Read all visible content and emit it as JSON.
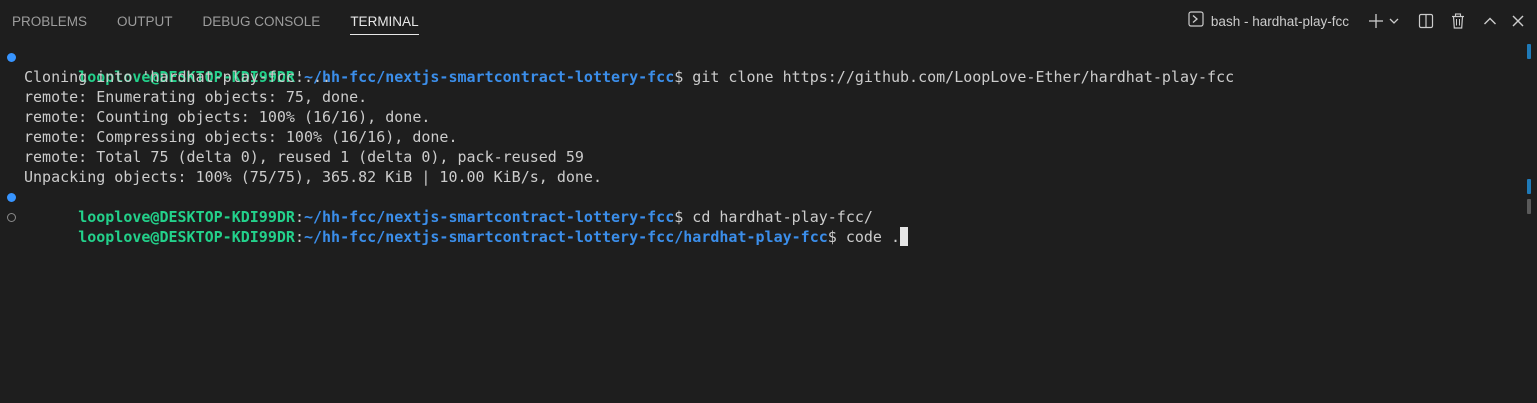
{
  "tabs": [
    {
      "label": "PROBLEMS",
      "active": false
    },
    {
      "label": "OUTPUT",
      "active": false
    },
    {
      "label": "DEBUG CONSOLE",
      "active": false
    },
    {
      "label": "TERMINAL",
      "active": true
    }
  ],
  "terminal_selector": {
    "icon": "terminal-icon",
    "label": "bash - hardhat-play-fcc"
  },
  "actions": {
    "new_terminal_icon": "plus-icon",
    "launch_profile_icon": "chevron-down-icon",
    "split_icon": "split-terminal-icon",
    "kill_icon": "trash-icon",
    "maximize_icon": "chevron-up-icon",
    "close_icon": "close-icon"
  },
  "colors": {
    "background": "#1e1e1e",
    "prompt_user": "#23d18b",
    "prompt_path": "#3b8eea",
    "text": "#cccccc",
    "decoration_success": "#3794ff",
    "ruler_mark": "#1f7ab8"
  },
  "terminal": {
    "lines": [
      {
        "type": "prompt",
        "decoration": "success",
        "user": "looplove@DESKTOP-KDI99DR",
        "sep": ":",
        "path": "~/hh-fcc/nextjs-smartcontract-lottery-fcc",
        "symbol": "$",
        "command": " git clone https://github.com/LoopLove-Ether/hardhat-play-fcc"
      },
      {
        "type": "output",
        "text": "Cloning into 'hardhat-play-fcc'..."
      },
      {
        "type": "output",
        "text": "remote: Enumerating objects: 75, done."
      },
      {
        "type": "output",
        "text": "remote: Counting objects: 100% (16/16), done."
      },
      {
        "type": "output",
        "text": "remote: Compressing objects: 100% (16/16), done."
      },
      {
        "type": "output",
        "text": "remote: Total 75 (delta 0), reused 1 (delta 0), pack-reused 59"
      },
      {
        "type": "output",
        "text": "Unpacking objects: 100% (75/75), 365.82 KiB | 10.00 KiB/s, done."
      },
      {
        "type": "prompt",
        "decoration": "success",
        "user": "looplove@DESKTOP-KDI99DR",
        "sep": ":",
        "path": "~/hh-fcc/nextjs-smartcontract-lottery-fcc",
        "symbol": "$",
        "command": " cd hardhat-play-fcc/"
      },
      {
        "type": "prompt",
        "decoration": "pending",
        "user": "looplove@DESKTOP-KDI99DR",
        "sep": ":",
        "path": "~/hh-fcc/nextjs-smartcontract-lottery-fcc/hardhat-play-fcc",
        "symbol": "$",
        "command": " code .",
        "cursor": true
      }
    ]
  }
}
